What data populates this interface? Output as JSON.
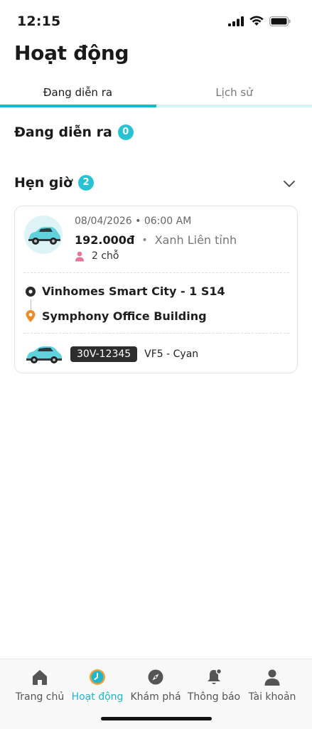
{
  "status_bar": {
    "time": "12:15"
  },
  "page_title": "Hoạt động",
  "tabs": [
    {
      "label": "Đang diễn ra",
      "active": true
    },
    {
      "label": "Lịch sử",
      "active": false
    }
  ],
  "ongoing": {
    "title": "Đang diễn ra",
    "count": "0"
  },
  "scheduled": {
    "title": "Hẹn giờ",
    "count": "2"
  },
  "trip": {
    "datetime": "08/04/2026 • 06:00 AM",
    "price": "192.000đ",
    "separator": "•",
    "service": "Xanh Liên tỉnh",
    "seats": "2 chỗ",
    "pickup": "Vinhomes Smart City - 1 S14",
    "dropoff": "Symphony Office Building",
    "plate": "30V-12345",
    "model": "VF5 - Cyan"
  },
  "nav": [
    {
      "label": "Trang chủ",
      "icon": "home-icon",
      "active": false
    },
    {
      "label": "Hoạt động",
      "icon": "activity-clock-icon",
      "active": true
    },
    {
      "label": "Khám phá",
      "icon": "compass-icon",
      "active": false
    },
    {
      "label": "Thông báo",
      "icon": "bell-icon",
      "active": false
    },
    {
      "label": "Tài khoản",
      "icon": "person-icon",
      "active": false
    }
  ],
  "colors": {
    "accent": "#19b8cc",
    "accent_light": "#d5f2f6",
    "orange": "#f08a24",
    "pink": "#e9739c"
  }
}
